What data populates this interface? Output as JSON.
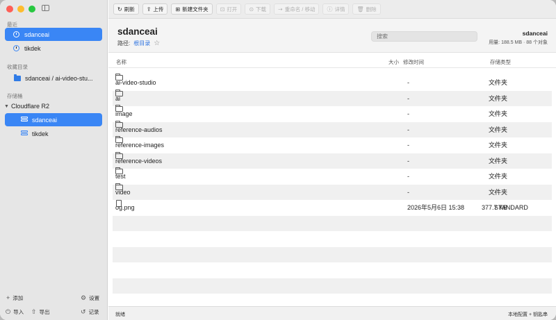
{
  "sidebar": {
    "recent_header": "最近",
    "recent": [
      {
        "label": "sdanceai",
        "selected": true,
        "icon": "clock-icon"
      },
      {
        "label": "tikdek",
        "selected": false,
        "icon": "clock-icon"
      }
    ],
    "favorites_header": "收藏目录",
    "favorites": [
      {
        "label": "sdanceai / ai-video-stu...",
        "icon": "folder-icon"
      }
    ],
    "buckets_header": "存储桶",
    "provider": "Cloudflare R2",
    "buckets": [
      {
        "label": "sdanceai",
        "selected": true,
        "icon": "server-icon"
      },
      {
        "label": "tikdek",
        "selected": false,
        "icon": "server-icon"
      }
    ],
    "bottom": {
      "add": "添加",
      "settings": "设置",
      "import": "导入",
      "export": "导出",
      "history": "记录"
    }
  },
  "toolbar": {
    "refresh": "刷新",
    "upload": "上传",
    "new_folder": "新建文件夹",
    "open": "打开",
    "download": "下载",
    "rename_move": "重命名 / 移动",
    "details": "详情",
    "delete": "删除"
  },
  "header": {
    "title": "sdanceai",
    "path_label": "路径:",
    "path_root": "根目录",
    "search_placeholder": "搜索",
    "account_name": "sdanceai",
    "usage": "用量: 188.5 MB · 88 个对象"
  },
  "table": {
    "columns": {
      "name": "名称",
      "size": "大小",
      "modified": "修改时间",
      "storage": "存储类型"
    },
    "rows": [
      {
        "name": "ai-video-studio",
        "size": "文件夹",
        "modified": "-",
        "storage": "-",
        "type": "folder"
      },
      {
        "name": "ai",
        "size": "文件夹",
        "modified": "-",
        "storage": "-",
        "type": "folder"
      },
      {
        "name": "image",
        "size": "文件夹",
        "modified": "-",
        "storage": "-",
        "type": "folder"
      },
      {
        "name": "reference-audios",
        "size": "文件夹",
        "modified": "-",
        "storage": "-",
        "type": "folder"
      },
      {
        "name": "reference-images",
        "size": "文件夹",
        "modified": "-",
        "storage": "-",
        "type": "folder"
      },
      {
        "name": "reference-videos",
        "size": "文件夹",
        "modified": "-",
        "storage": "-",
        "type": "folder"
      },
      {
        "name": "test",
        "size": "文件夹",
        "modified": "-",
        "storage": "-",
        "type": "folder"
      },
      {
        "name": "video",
        "size": "文件夹",
        "modified": "-",
        "storage": "-",
        "type": "folder"
      },
      {
        "name": "og.png",
        "size": "377.7 KB",
        "modified": "2026年5月6日 15:38",
        "storage": "STANDARD",
        "type": "file"
      }
    ]
  },
  "status": {
    "left": "就绪",
    "right": "本地配置 + 钥匙串"
  }
}
